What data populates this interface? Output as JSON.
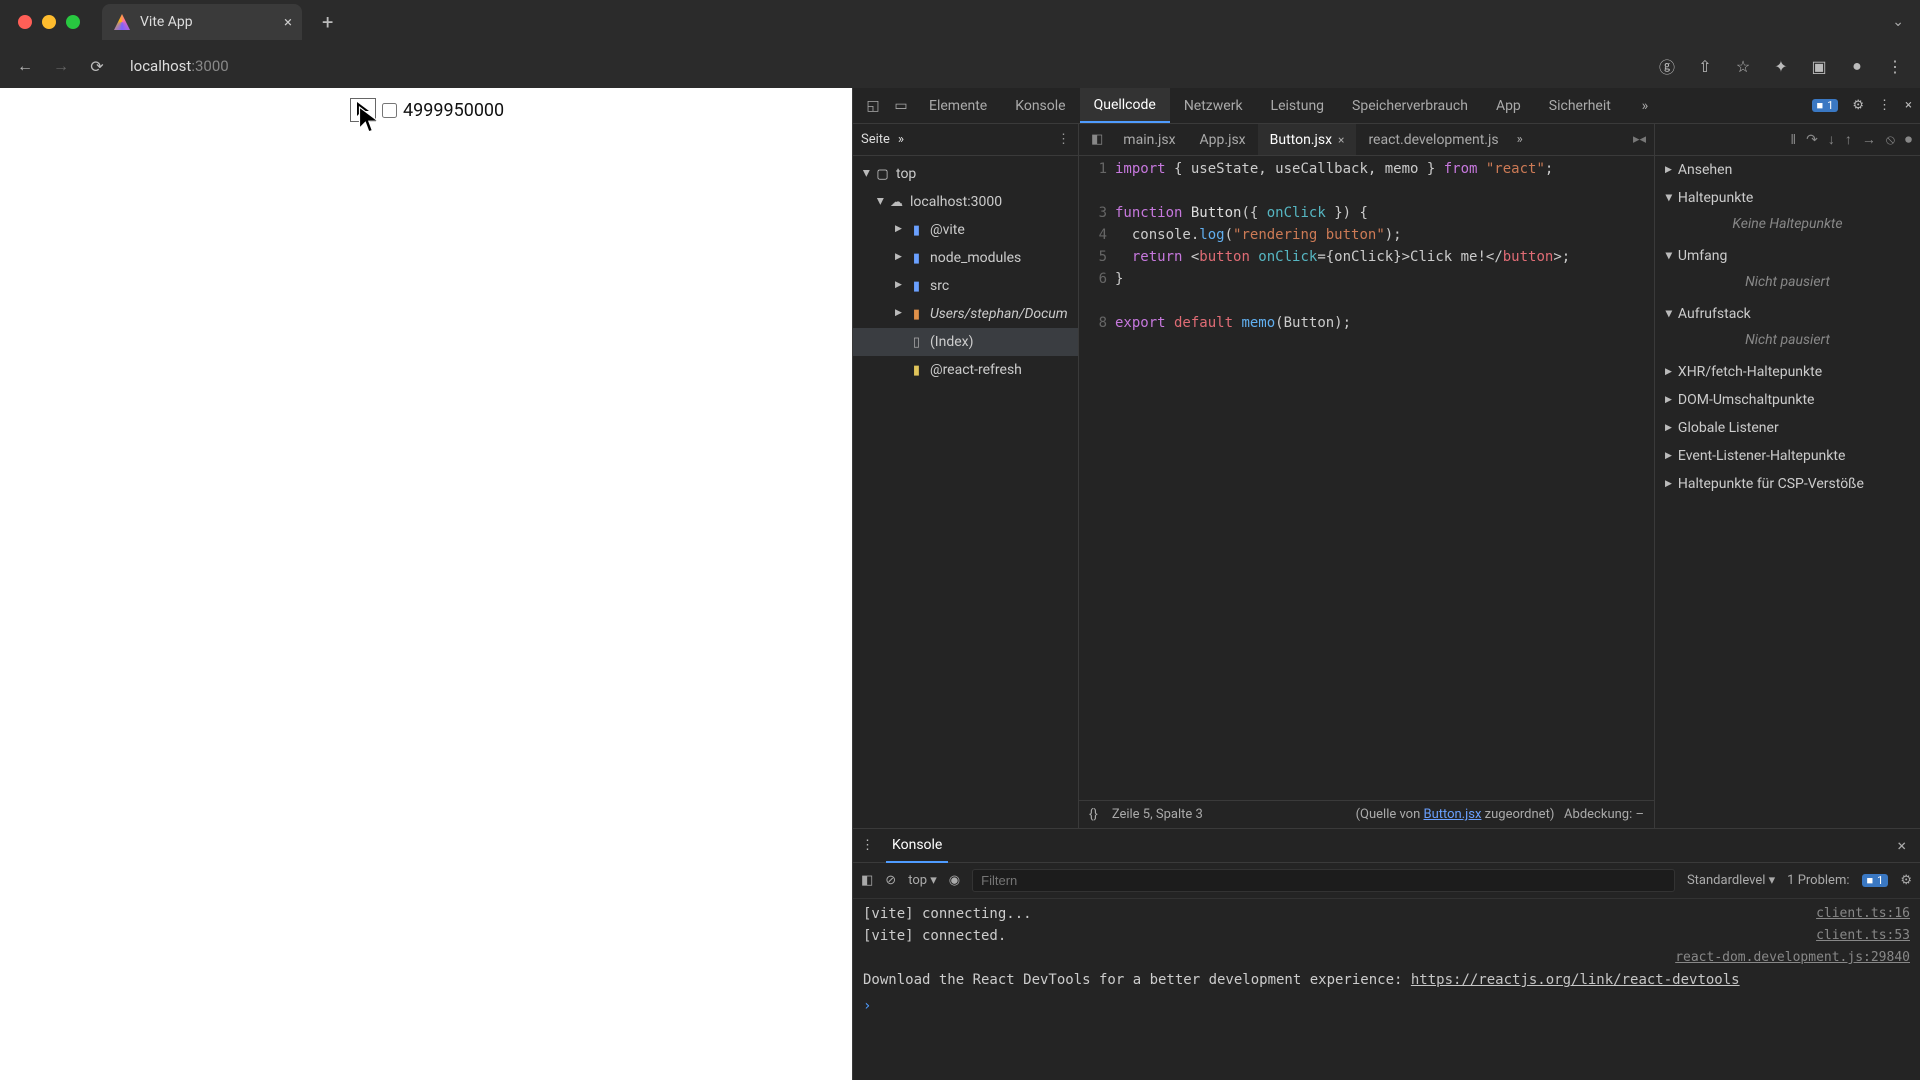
{
  "browser": {
    "tab_title": "Vite App",
    "url_host": "localhost",
    "url_port": ":3000"
  },
  "page": {
    "count": "4999950000"
  },
  "devtools": {
    "top_tabs": [
      "Elemente",
      "Konsole",
      "Quellcode",
      "Netzwerk",
      "Leistung",
      "Speicherverbrauch",
      "App",
      "Sicherheit"
    ],
    "active_tab": "Quellcode",
    "issue_badge": "1",
    "side": {
      "title": "Seite",
      "tree": {
        "top": "top",
        "origin": "localhost:3000",
        "vite": "@vite",
        "node_modules": "node_modules",
        "src": "src",
        "users": "Users/stephan/Docum",
        "index": "(Index)",
        "react_refresh": "@react-refresh"
      }
    },
    "editor": {
      "tabs": [
        "main.jsx",
        "App.jsx",
        "Button.jsx",
        "react.development.js"
      ],
      "active": "Button.jsx",
      "line_numbers": [
        "1",
        "",
        "3",
        "4",
        "5",
        "6",
        "",
        "8",
        ""
      ],
      "line5_spalte3": "Zeile 5, Spalte 3",
      "link": "Button.jsx",
      "quelle_pre": "(Quelle von ",
      "quelle_post": " zugeordnet)",
      "abdeckung": "Abdeckung: –",
      "code": {
        "l1_import": "import",
        "l1_names": " { useState, useCallback, memo } ",
        "l1_from": "from",
        "l1_react": " \"react\"",
        "l1_semi": ";",
        "l3_fn": "function",
        "l3_name": " Button",
        "l3_args": "({ ",
        "l3_onclick": "onClick",
        "l3_args2": " }) {",
        "l4_a": "  console.",
        "l4_log": "log",
        "l4_b": "(",
        "l4_str": "\"rendering button\"",
        "l4_c": ");",
        "l5_ret": "  return",
        "l5_open": " <",
        "l5_tag": "button",
        "l5_attr": " onClick",
        "l5_eq": "={onClick}>",
        "l5_text": "Click me!",
        "l5_close": "</",
        "l5_tag2": "button",
        "l5_end": ">;",
        "l6": "}",
        "l8_export": "export",
        "l8_default": " default",
        "l8_memo": " memo",
        "l8_call": "(Button);"
      }
    },
    "debug": {
      "ansehen": "Ansehen",
      "haltepunkte": "Haltepunkte",
      "keine_haltepunkte": "Keine Haltepunkte",
      "umfang": "Umfang",
      "nicht_pausiert": "Nicht pausiert",
      "aufrufstack": "Aufrufstack",
      "xhr": "XHR/fetch-Haltepunkte",
      "dom": "DOM-Umschaltpunkte",
      "global": "Globale Listener",
      "event": "Event-Listener-Haltepunkte",
      "csp": "Haltepunkte für CSP-Verstöße"
    },
    "console": {
      "tab": "Konsole",
      "ctx": "top",
      "filter_placeholder": "Filtern",
      "level": "Standardlevel",
      "problem_label": "1 Problem:",
      "problem_n": "1",
      "log1": "[vite] connecting...",
      "log1_loc": "client.ts:16",
      "log2": "[vite] connected.",
      "log2_loc": "client.ts:53",
      "log3_loc": "react-dom.development.js:29840",
      "log3_pre": "Download the React DevTools for a better development experience: ",
      "log3_link": "https://reactjs.org/link/react-devtools"
    }
  }
}
